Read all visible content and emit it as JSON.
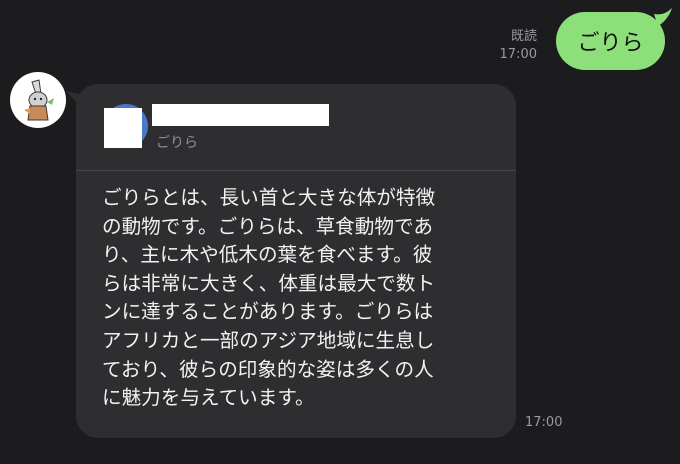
{
  "sent_message": {
    "text": "ごりら",
    "read_label": "既読",
    "time": "17:00",
    "bubble_color": "#8de079"
  },
  "received_message": {
    "avatar_icon": "gorilla-character-icon",
    "profile_card": {
      "subtitle": "ごりら"
    },
    "lines": [
      "ごりらとは、長い首と大きな体が特徴",
      "の動物です。ごりらは、草食動物であ",
      "り、主に木や低木の葉を食べます。彼",
      "らは非常に大きく、体重は最大で数ト",
      "ンに達することがあります。ごりらは",
      "アフリカと一部のアジア地域に生息し",
      "ており、彼らの印象的な姿は多くの人",
      "に魅力を与えています。"
    ],
    "time": "17:00",
    "bubble_color": "#2e2e31"
  },
  "colors": {
    "background": "#1c1c1e",
    "profile_ring": "#4a78c9"
  }
}
